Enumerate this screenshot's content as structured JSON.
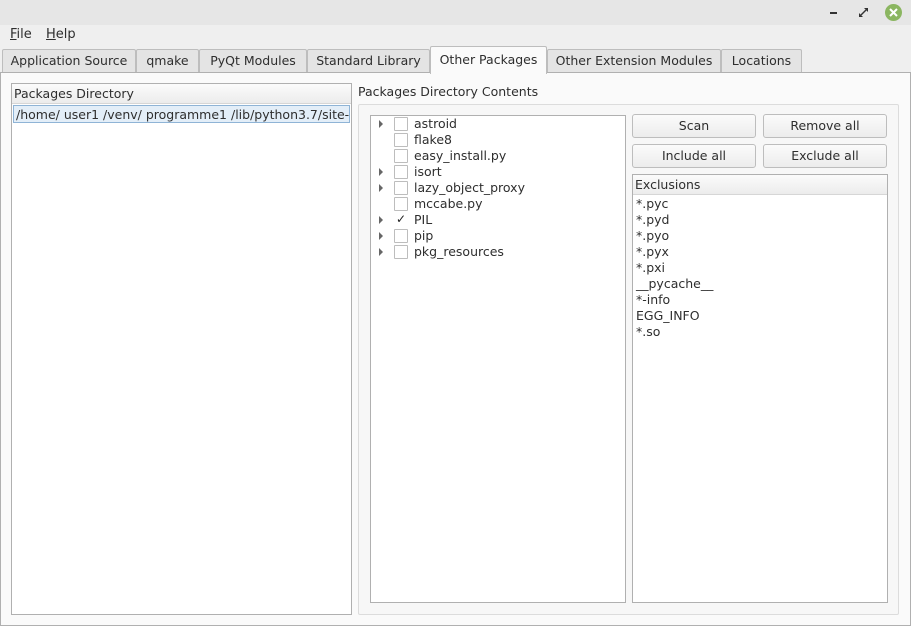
{
  "window": {
    "controls": {
      "minimize_icon": "minimize-icon",
      "maximize_icon": "maximize-icon",
      "close_icon": "close-icon"
    },
    "close_color": "#8bb661"
  },
  "menubar": {
    "items": [
      {
        "label": "File",
        "mnemonic": "F",
        "rest": "ile"
      },
      {
        "label": "Help",
        "mnemonic": "H",
        "rest": "elp"
      }
    ]
  },
  "tabs": [
    {
      "label": "Application Source",
      "active": false
    },
    {
      "label": "qmake",
      "active": false
    },
    {
      "label": "PyQt Modules",
      "active": false
    },
    {
      "label": "Standard Library",
      "active": false
    },
    {
      "label": "Other Packages",
      "active": true
    },
    {
      "label": "Other Extension Modules",
      "active": false
    },
    {
      "label": "Locations",
      "active": false
    }
  ],
  "packages_directory": {
    "header": "Packages Directory",
    "rows": [
      "/home/ user1 /venv/ programme1 /lib/python3.7/site-..."
    ]
  },
  "contents": {
    "title": "Packages Directory Contents",
    "tree": [
      {
        "label": "astroid",
        "expandable": true,
        "checked": false
      },
      {
        "label": "flake8",
        "expandable": false,
        "checked": false
      },
      {
        "label": "easy_install.py",
        "expandable": false,
        "checked": false
      },
      {
        "label": "isort",
        "expandable": true,
        "checked": false
      },
      {
        "label": "lazy_object_proxy",
        "expandable": true,
        "checked": false
      },
      {
        "label": "mccabe.py",
        "expandable": false,
        "checked": false
      },
      {
        "label": "PIL",
        "expandable": true,
        "checked": true
      },
      {
        "label": "pip",
        "expandable": true,
        "checked": false
      },
      {
        "label": "pkg_resources",
        "expandable": true,
        "checked": false
      }
    ],
    "check_mark": "✓"
  },
  "buttons": {
    "scan": "Scan",
    "remove_all": "Remove all",
    "include_all": "Include all",
    "exclude_all": "Exclude all"
  },
  "exclusions": {
    "header": "Exclusions",
    "items": [
      "*.pyc",
      "*.pyd",
      "*.pyo",
      "*.pyx",
      "*.pxi",
      "__pycache__",
      "*-info",
      "EGG_INFO",
      "*.so"
    ]
  }
}
